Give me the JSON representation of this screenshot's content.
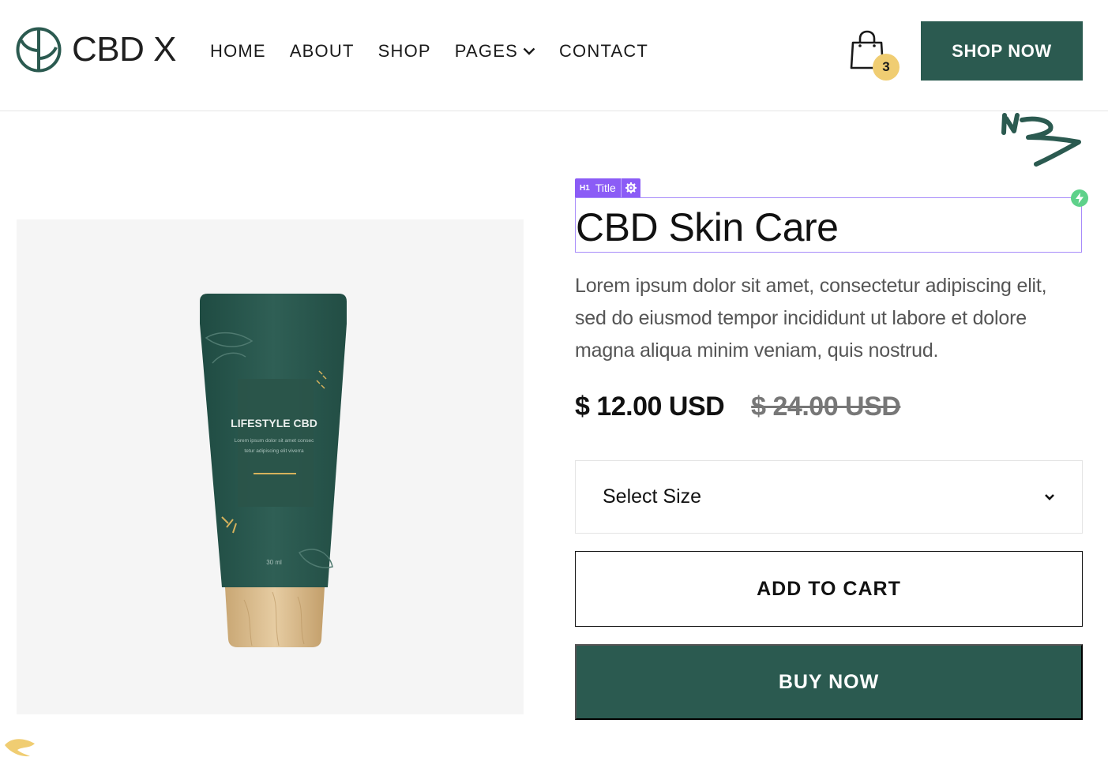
{
  "header": {
    "logo_text": "CBD X",
    "nav": [
      {
        "label": "HOME"
      },
      {
        "label": "ABOUT"
      },
      {
        "label": "SHOP"
      },
      {
        "label": "PAGES"
      },
      {
        "label": "CONTACT"
      }
    ],
    "cart_count": "3",
    "shop_now_label": "SHOP NOW"
  },
  "editor": {
    "tag_h": "H1",
    "tag_label": "Title"
  },
  "product": {
    "title": "CBD Skin Care",
    "description": "Lorem ipsum dolor sit amet, consectetur adipiscing elit, sed do eiusmod tempor incididunt ut labore et dolore magna aliqua minim veniam, quis nostrud.",
    "price": "$ 12.00 USD",
    "old_price": "$ 24.00 USD",
    "select_size_label": "Select Size",
    "add_to_cart_label": "ADD TO CART",
    "buy_now_label": "BUY NOW",
    "tube_label": "LIFESTYLE CBD",
    "tube_text_1": "Lorem ipsum dolor sit amet consec",
    "tube_text_2": "tetur adipiscing elit viverra",
    "tube_volume": "30 ml"
  },
  "colors": {
    "brand_green": "#2b5a50",
    "accent_yellow": "#f0cd72",
    "editor_purple": "#8b5cf6",
    "bolt_green": "#5ed18a"
  }
}
